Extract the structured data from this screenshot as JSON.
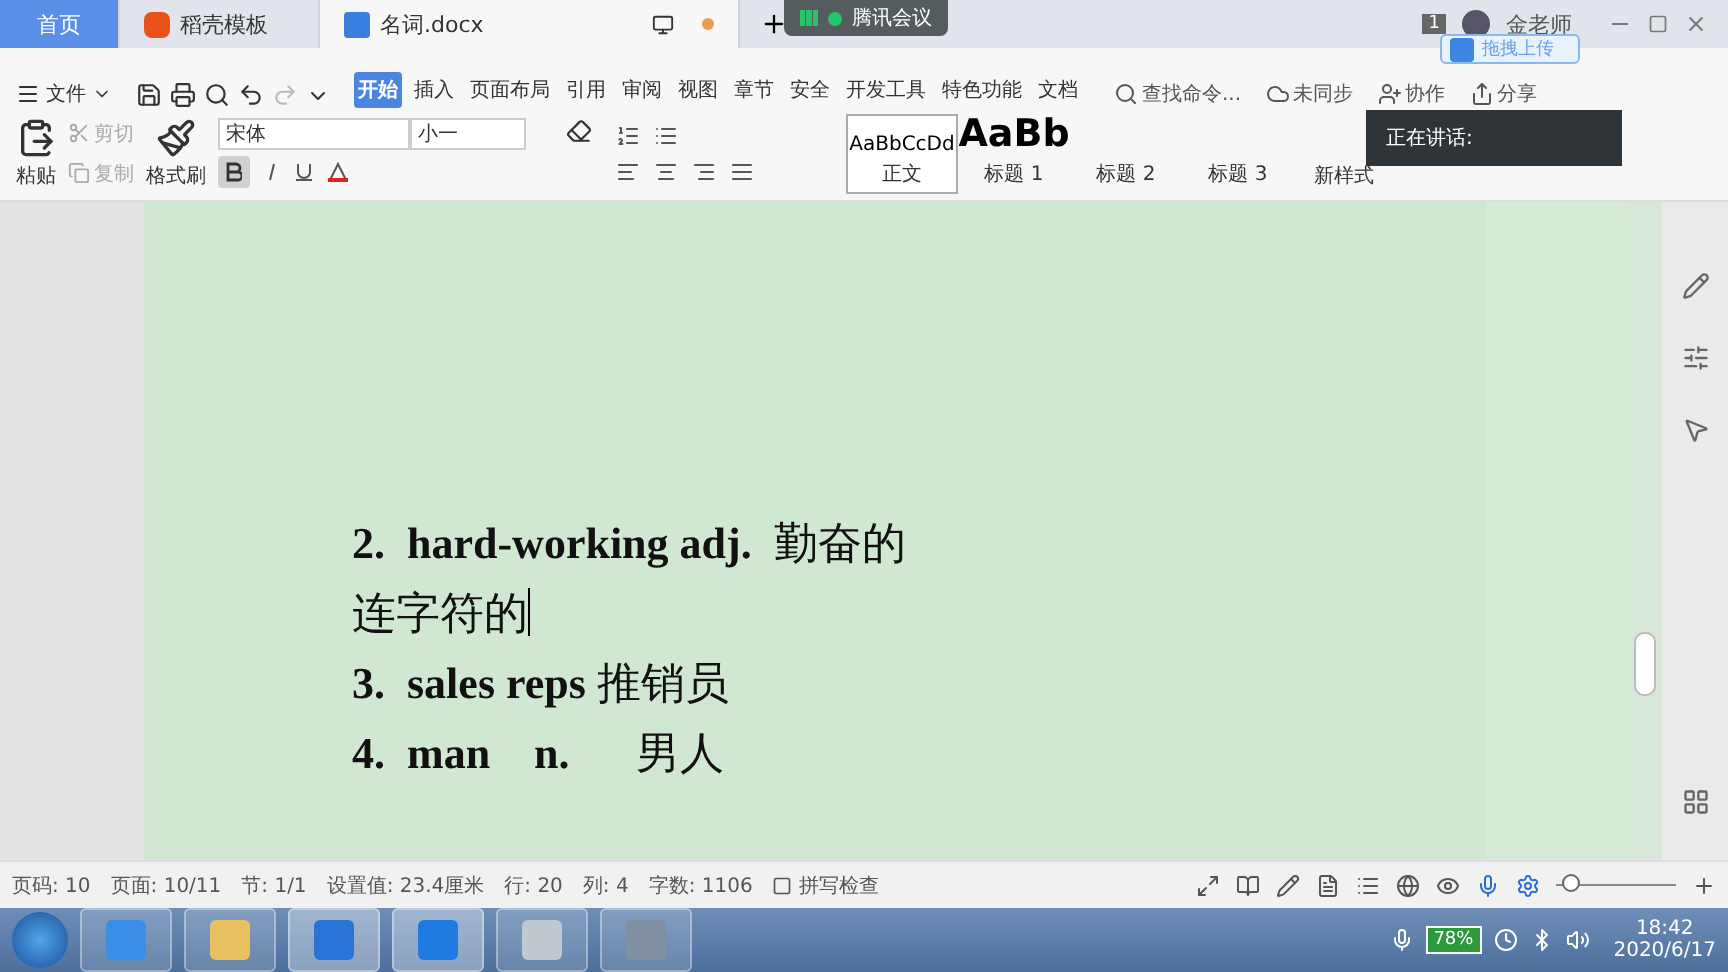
{
  "tabs": [
    {
      "kind": "home",
      "label": "首页",
      "selected": false
    },
    {
      "kind": "template",
      "label": "稻壳模板",
      "selected": false
    },
    {
      "kind": "doc",
      "label": "名词.docx",
      "selected": true
    }
  ],
  "meeting": {
    "title": "腾讯会议"
  },
  "account": {
    "badge": "1",
    "name": "金老师"
  },
  "upload_tip": "拖拽上传",
  "menu": {
    "file": "文件",
    "items": [
      {
        "label": "开始",
        "selected": true
      },
      {
        "label": "插入",
        "selected": false
      },
      {
        "label": "页面布局",
        "selected": false
      },
      {
        "label": "引用",
        "selected": false
      },
      {
        "label": "审阅",
        "selected": false
      },
      {
        "label": "视图",
        "selected": false
      },
      {
        "label": "章节",
        "selected": false
      },
      {
        "label": "安全",
        "selected": false
      },
      {
        "label": "开发工具",
        "selected": false
      },
      {
        "label": "特色功能",
        "selected": false
      },
      {
        "label": "文档",
        "selected": false
      }
    ],
    "search": {
      "placeholder": "查找命令..."
    },
    "sync": "未同步",
    "collab": "协作",
    "share": "分享"
  },
  "ribbon": {
    "paste": "粘贴",
    "cut": {
      "label": "剪切",
      "disabled": true
    },
    "copy": {
      "label": "复制",
      "disabled": true
    },
    "format_painter": "格式刷",
    "font": "宋体",
    "size": "小一",
    "bold_active": true,
    "styles": [
      {
        "preview": "AaBbCcDd",
        "label": "正文",
        "selected": true
      },
      {
        "preview": "AaBb",
        "label": "标题 1",
        "selected": false
      },
      {
        "label": "标题 2",
        "selected": false
      },
      {
        "label": "标题 3",
        "selected": false
      }
    ],
    "new_style": "新样式"
  },
  "speaking": {
    "label": "正在讲话:"
  },
  "document": {
    "lines": [
      {
        "text": "**2.  hard-working adj.**  勤奋的",
        "caret": false
      },
      {
        "text": "连字符的",
        "caret": true
      },
      {
        "text": "**3.  sales reps** 推销员",
        "caret": false
      },
      {
        "text": "**4.  man    n.**      男人",
        "caret": false
      }
    ]
  },
  "status_bar": {
    "items": [
      "页码: 10",
      "页面: 10/11",
      "节: 1/1",
      "设置值: 23.4厘米",
      "行: 20",
      "列: 4",
      "字数: 1106"
    ],
    "spell_check": "拼写检查",
    "zoom": {
      "level": 0.05
    }
  },
  "taskbar": {
    "battery": "78%",
    "time": "18:42",
    "date": "2020/6/17"
  }
}
